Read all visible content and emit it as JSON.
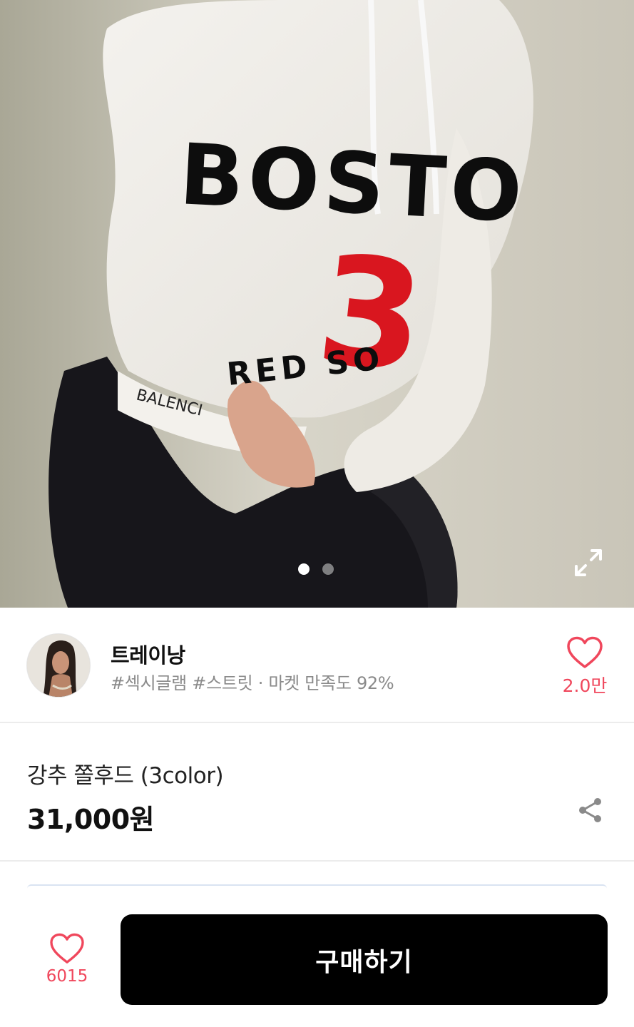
{
  "photo": {
    "print_text_main": "BOSTO",
    "print_number": "3",
    "print_text_small": "RED SO",
    "waistband_text": "BALENCI",
    "carousel": {
      "total": 2,
      "active": 1
    },
    "expand_icon": "expand-icon"
  },
  "shop": {
    "name": "트레이낭",
    "tags": "#섹시글램 #스트릿 · 마켓 만족도 92%",
    "like_count": "2.0만",
    "like_icon": "heart-outline-icon",
    "accent_color": "#f0475c"
  },
  "product": {
    "title": "강추 쫄후드 (3color)",
    "price": "31,000원",
    "share_icon": "share-icon"
  },
  "bottom_bar": {
    "wish_count": "6015",
    "wish_icon": "heart-outline-icon",
    "buy_label": "구매하기",
    "buy_color": "#000000"
  }
}
